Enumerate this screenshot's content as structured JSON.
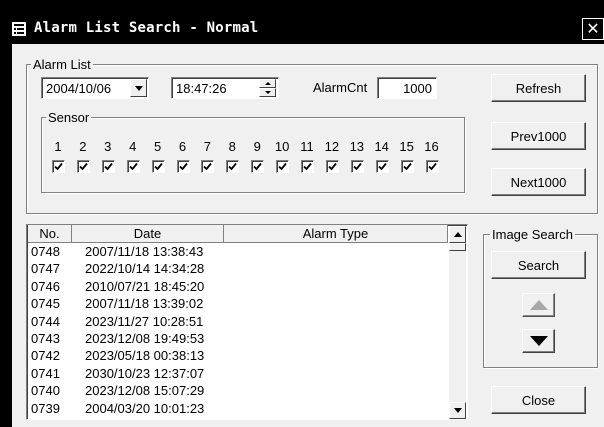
{
  "window": {
    "title": "Alarm List Search - Normal",
    "close_glyph": "✕"
  },
  "alarm_list": {
    "group_title": "Alarm List",
    "date_value": "2004/10/06",
    "time_value": "18:47:26",
    "alarm_cnt_label": "AlarmCnt",
    "alarm_cnt_value": "1000",
    "sensor": {
      "group_title": "Sensor",
      "numbers": [
        "1",
        "2",
        "3",
        "4",
        "5",
        "6",
        "7",
        "8",
        "9",
        "10",
        "11",
        "12",
        "13",
        "14",
        "15",
        "16"
      ],
      "checked": [
        true,
        true,
        true,
        true,
        true,
        true,
        true,
        true,
        true,
        true,
        true,
        true,
        true,
        true,
        true,
        true
      ]
    }
  },
  "buttons": {
    "refresh": "Refresh",
    "prev": "Prev1000",
    "next": "Next1000",
    "close": "Close"
  },
  "results": {
    "columns": [
      "No.",
      "Date",
      "Alarm Type"
    ],
    "rows": [
      {
        "no": "0748",
        "date": "2007/11/18 13:38:43",
        "type": ""
      },
      {
        "no": "0747",
        "date": "2022/10/14 14:34:28",
        "type": ""
      },
      {
        "no": "0746",
        "date": "2010/07/21 18:45:20",
        "type": ""
      },
      {
        "no": "0745",
        "date": "2007/11/18 13:39:02",
        "type": ""
      },
      {
        "no": "0744",
        "date": "2023/11/27 10:28:51",
        "type": ""
      },
      {
        "no": "0743",
        "date": "2023/12/08 19:49:53",
        "type": ""
      },
      {
        "no": "0742",
        "date": "2023/05/18 00:38:13",
        "type": ""
      },
      {
        "no": "0741",
        "date": "2030/10/23 12:37:07",
        "type": ""
      },
      {
        "no": "0740",
        "date": "2023/12/08 15:07:29",
        "type": ""
      },
      {
        "no": "0739",
        "date": "2004/03/20 10:01:23",
        "type": ""
      }
    ]
  },
  "image_search": {
    "group_title": "Image Search",
    "search_label": "Search"
  }
}
